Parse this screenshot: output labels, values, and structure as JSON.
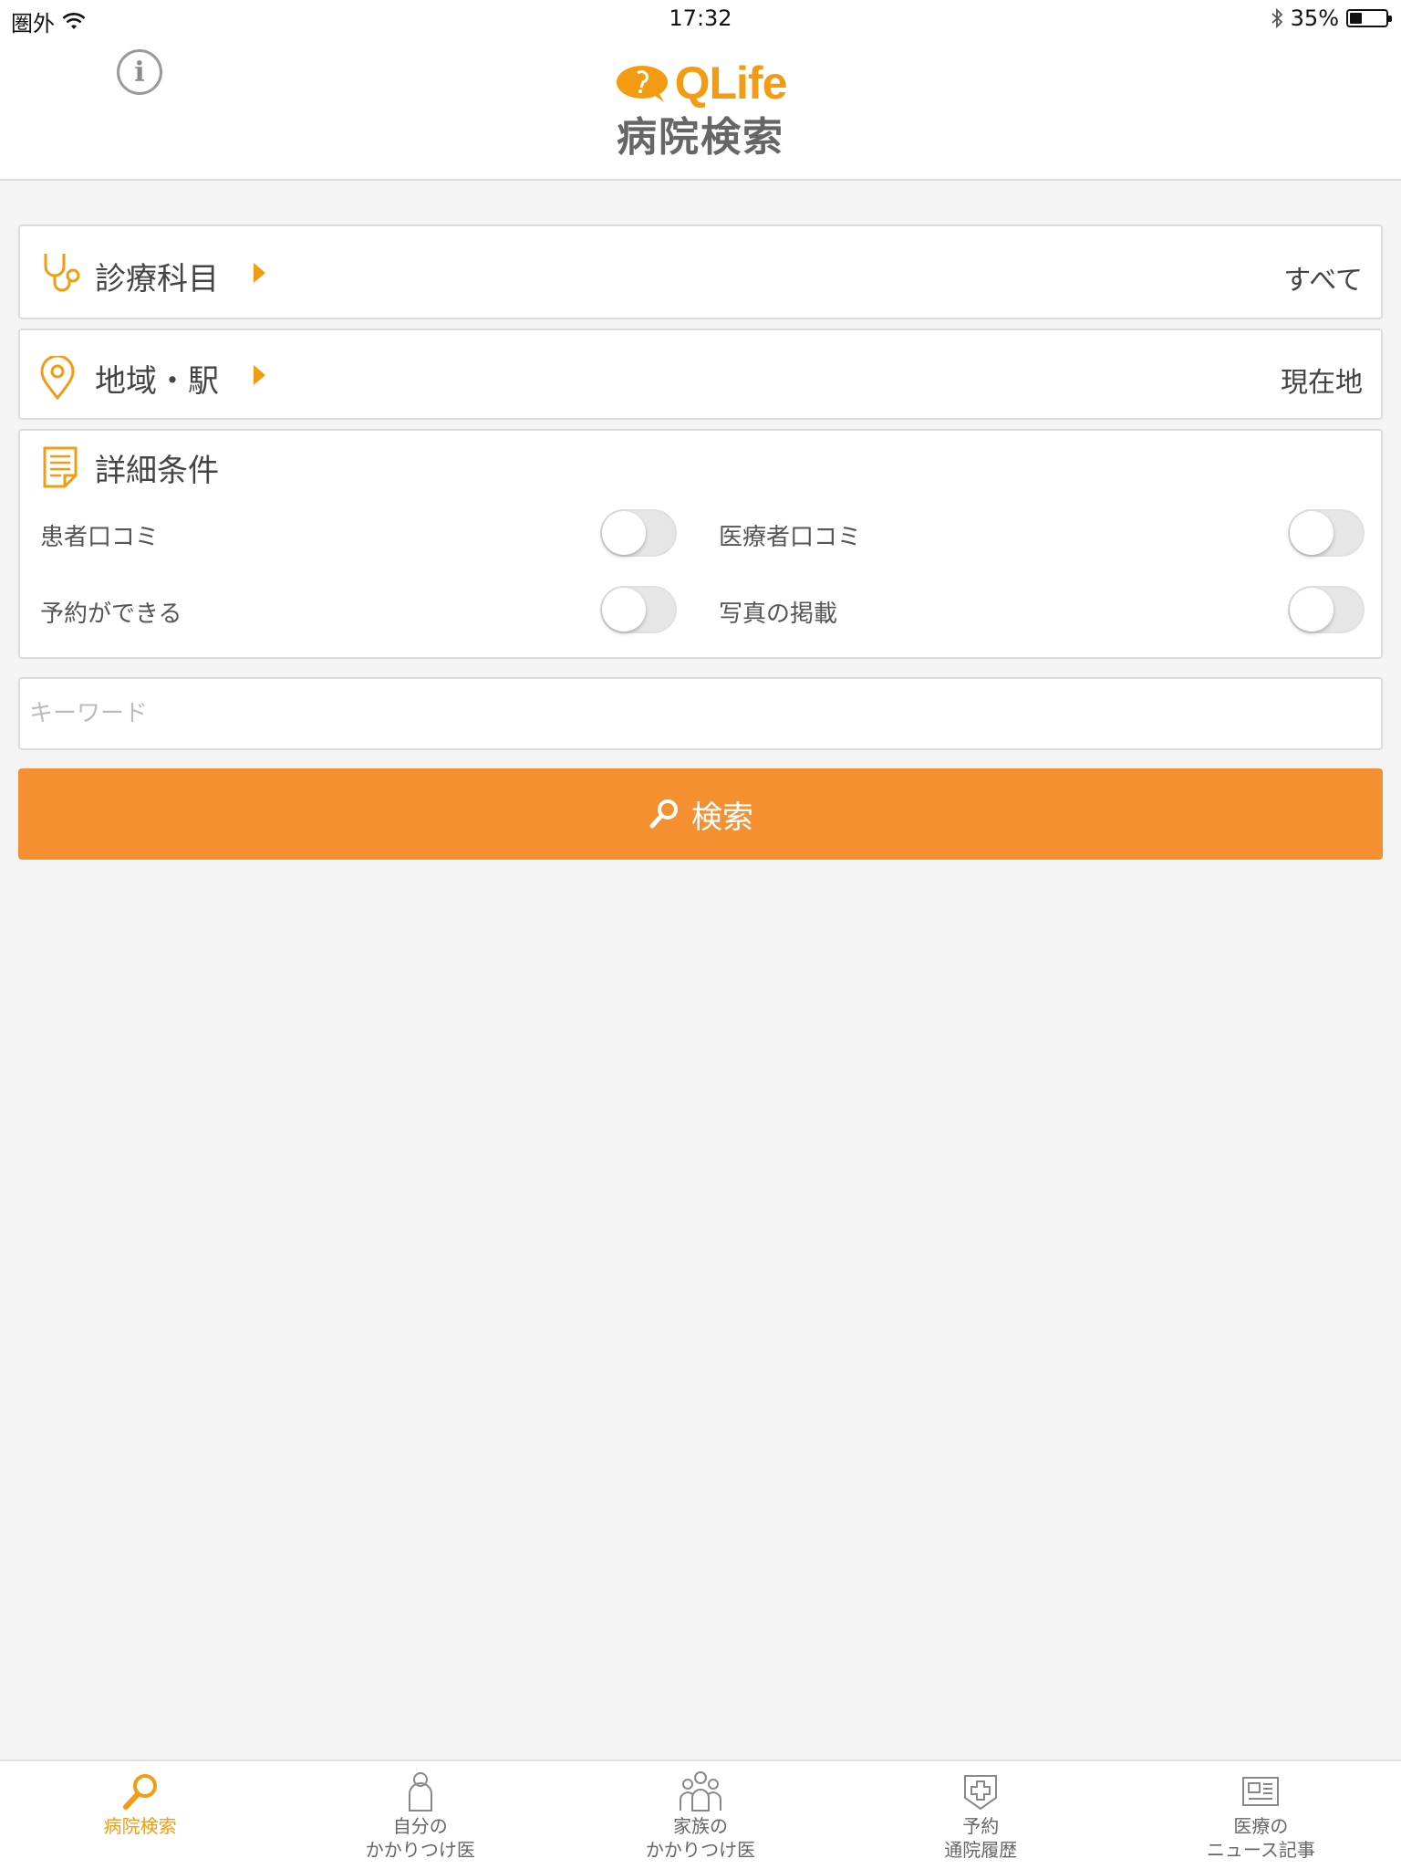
{
  "status_bar": {
    "carrier": "圏外",
    "time": "17:32",
    "battery_percent": "35%",
    "battery_level": 0.35
  },
  "header": {
    "brand": "QLife",
    "subtitle": "病院検索"
  },
  "filters": {
    "department": {
      "label": "診療科目",
      "value": "すべて"
    },
    "area": {
      "label": "地域・駅",
      "value": "現在地"
    }
  },
  "details": {
    "title": "詳細条件",
    "toggles": [
      {
        "label": "患者口コミ",
        "on": false
      },
      {
        "label": "医療者口コミ",
        "on": false
      },
      {
        "label": "予約ができる",
        "on": false
      },
      {
        "label": "写真の掲載",
        "on": false
      }
    ]
  },
  "keyword": {
    "placeholder": "キーワード",
    "value": ""
  },
  "search_button": {
    "label": "検索"
  },
  "tabs": [
    {
      "line1": "病院検索",
      "line2": ""
    },
    {
      "line1": "自分の",
      "line2": "かかりつけ医"
    },
    {
      "line1": "家族の",
      "line2": "かかりつけ医"
    },
    {
      "line1": "予約",
      "line2": "通院履歴"
    },
    {
      "line1": "医療の",
      "line2": "ニュース記事"
    }
  ],
  "colors": {
    "accent": "#f59031",
    "brand": "#f39c12",
    "background": "#f4f4f4"
  }
}
